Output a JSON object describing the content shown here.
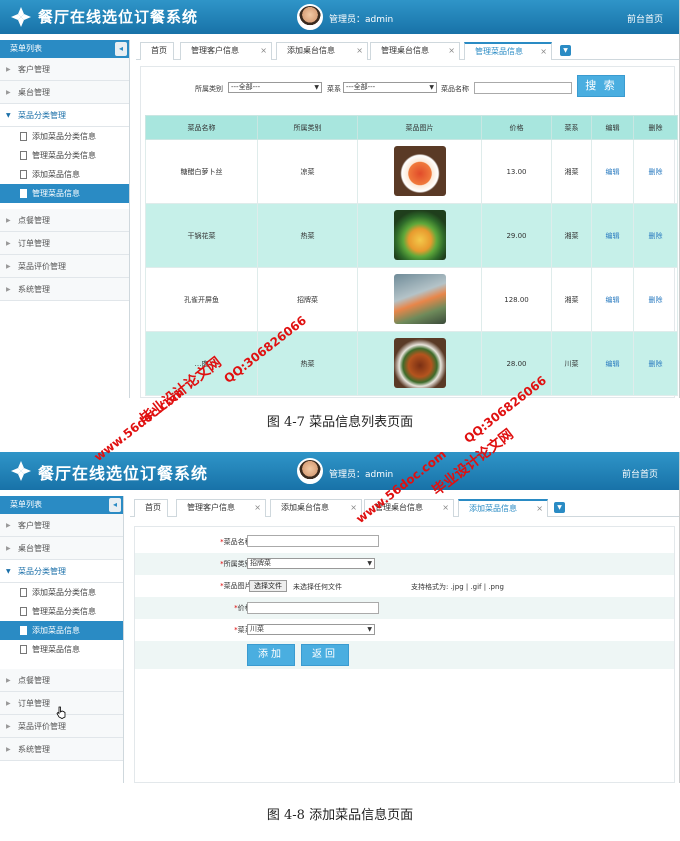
{
  "app": {
    "title": "餐厅在线选位订餐系统",
    "admin_label": "管理员：admin",
    "front_link": "前台首页"
  },
  "sidebar": {
    "header": "菜单列表",
    "toggle": "◂",
    "groups": [
      {
        "label": "客户管理"
      },
      {
        "label": "桌台管理"
      },
      {
        "label": "菜品分类管理",
        "open": true,
        "items": [
          "添加菜品分类信息",
          "管理菜品分类信息",
          "添加菜品信息",
          "管理菜品信息"
        ]
      },
      {
        "label": "点餐管理"
      },
      {
        "label": "订单管理"
      },
      {
        "label": "菜品评价管理"
      },
      {
        "label": "系统管理"
      }
    ]
  },
  "screen1": {
    "tabs": [
      "首页",
      "管理客户信息",
      "添加桌台信息",
      "管理桌台信息",
      "管理菜品信息"
    ],
    "active_tab": "管理菜品信息",
    "search": {
      "category_label": "所属类别",
      "category_value": "---全部---",
      "cuisine_label": "菜系",
      "cuisine_value": "---全部---",
      "name_label": "菜品名称",
      "button": "搜 索"
    },
    "columns": [
      "菜品名称",
      "所属类别",
      "菜品图片",
      "价格",
      "菜系",
      "编辑",
      "删除"
    ],
    "rows": [
      {
        "name": "糖醋白萝卜丝",
        "category": "凉菜",
        "price": "13.00",
        "cuisine": "湘菜",
        "edit": "编辑",
        "delete": "删除"
      },
      {
        "name": "干锅花菜",
        "category": "热菜",
        "price": "29.00",
        "cuisine": "湘菜",
        "edit": "编辑",
        "delete": "删除"
      },
      {
        "name": "孔雀开屏鱼",
        "category": "招牌菜",
        "price": "128.00",
        "cuisine": "湘菜",
        "edit": "编辑",
        "delete": "删除"
      },
      {
        "name": "…肉",
        "category": "热菜",
        "price": "28.00",
        "cuisine": "川菜",
        "edit": "编辑",
        "delete": "删除"
      }
    ]
  },
  "caption1": "图 4-7 菜品信息列表页面",
  "screen2": {
    "tabs": [
      "首页",
      "管理客户信息",
      "添加桌台信息",
      "管理桌台信息",
      "添加菜品信息"
    ],
    "active_tab": "添加菜品信息",
    "form": {
      "name_label": "菜品名称:",
      "name_value": "",
      "category_label": "所属类别:",
      "category_value": "招牌菜",
      "image_label": "菜品图片:",
      "file_button": "选择文件",
      "file_status": "未选择任何文件",
      "format_hint": "支持格式为: .jpg | .gif | .png",
      "price_label": "价格:",
      "price_value": "",
      "cuisine_label": "菜系:",
      "cuisine_value": "川菜",
      "submit": "添加",
      "back": "返回"
    }
  },
  "caption2": "图 4-8 添加菜品信息页面",
  "watermarks": {
    "site": "www.56doc.com",
    "brand": "毕业设计论文网",
    "qq": "QQ:306826066"
  },
  "colors": {
    "header": "#1e7fb8",
    "accent": "#2a8bc4",
    "table_head": "#a8e6de",
    "row_alt": "#c6f0e9",
    "watermark": "#e01010"
  }
}
